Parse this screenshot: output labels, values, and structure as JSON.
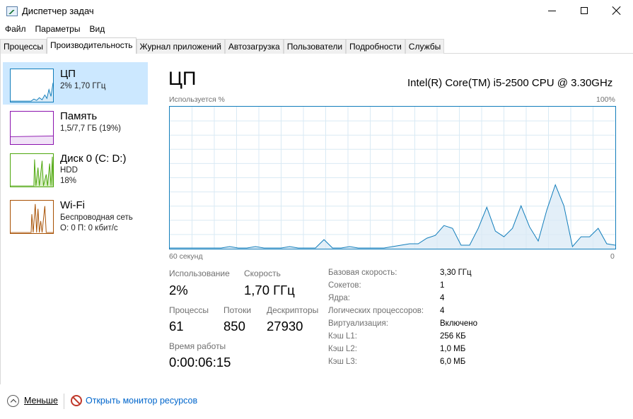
{
  "window": {
    "title": "Диспетчер задач"
  },
  "menu": [
    "Файл",
    "Параметры",
    "Вид"
  ],
  "tabs": [
    "Процессы",
    "Производительность",
    "Журнал приложений",
    "Автозагрузка",
    "Пользователи",
    "Подробности",
    "Службы"
  ],
  "active_tab": 1,
  "sidebar": {
    "items": [
      {
        "title": "ЦП",
        "line1": "2%  1,70 ГГц",
        "line2": "",
        "color": "#117dbb"
      },
      {
        "title": "Память",
        "line1": "1,5/7,7 ГБ (19%)",
        "line2": "",
        "color": "#8b12ae"
      },
      {
        "title": "Диск 0 (C: D:)",
        "line1": "HDD",
        "line2": "18%",
        "color": "#4da60c"
      },
      {
        "title": "Wi-Fi",
        "line1": "Беспроводная сеть",
        "line2": "О: 0 П: 0 кбит/с",
        "color": "#a74f01"
      }
    ]
  },
  "main": {
    "title": "ЦП",
    "model": "Intel(R) Core(TM) i5-2500 CPU @ 3.30GHz",
    "graph": {
      "top_left": "Используется %",
      "top_right": "100%",
      "bottom_left": "60 секунд",
      "bottom_right": "0",
      "color": "#117dbb",
      "values": [
        0,
        0,
        0,
        0,
        0,
        0,
        0,
        1,
        0,
        0,
        1,
        0,
        0,
        0,
        1,
        0,
        0,
        0,
        6,
        0,
        0,
        1,
        0,
        0,
        0,
        0,
        1,
        2,
        3,
        3,
        7,
        9,
        16,
        14,
        2,
        2,
        14,
        29,
        12,
        8,
        14,
        30,
        15,
        5,
        27,
        45,
        30,
        1,
        8,
        8,
        14,
        3,
        2
      ]
    },
    "stats": {
      "usage_label": "Использование",
      "usage_value": "2%",
      "speed_label": "Скорость",
      "speed_value": "1,70 ГГц",
      "processes_label": "Процессы",
      "processes_value": "61",
      "threads_label": "Потоки",
      "threads_value": "850",
      "handles_label": "Дескрипторы",
      "handles_value": "27930",
      "uptime_label": "Время работы",
      "uptime_value": "0:00:06:15"
    },
    "specs": [
      {
        "key": "Базовая скорость:",
        "value": "3,30 ГГц"
      },
      {
        "key": "Сокетов:",
        "value": "1"
      },
      {
        "key": "Ядра:",
        "value": "4"
      },
      {
        "key": "Логических процессоров:",
        "value": "4"
      },
      {
        "key": "Виртуализация:",
        "value": "Включено"
      },
      {
        "key": "Кэш L1:",
        "value": "256 КБ"
      },
      {
        "key": "Кэш L2:",
        "value": "1,0 МБ"
      },
      {
        "key": "Кэш L3:",
        "value": "6,0 МБ"
      }
    ]
  },
  "footer": {
    "less": "Меньше",
    "resource_monitor": "Открыть монитор ресурсов"
  }
}
